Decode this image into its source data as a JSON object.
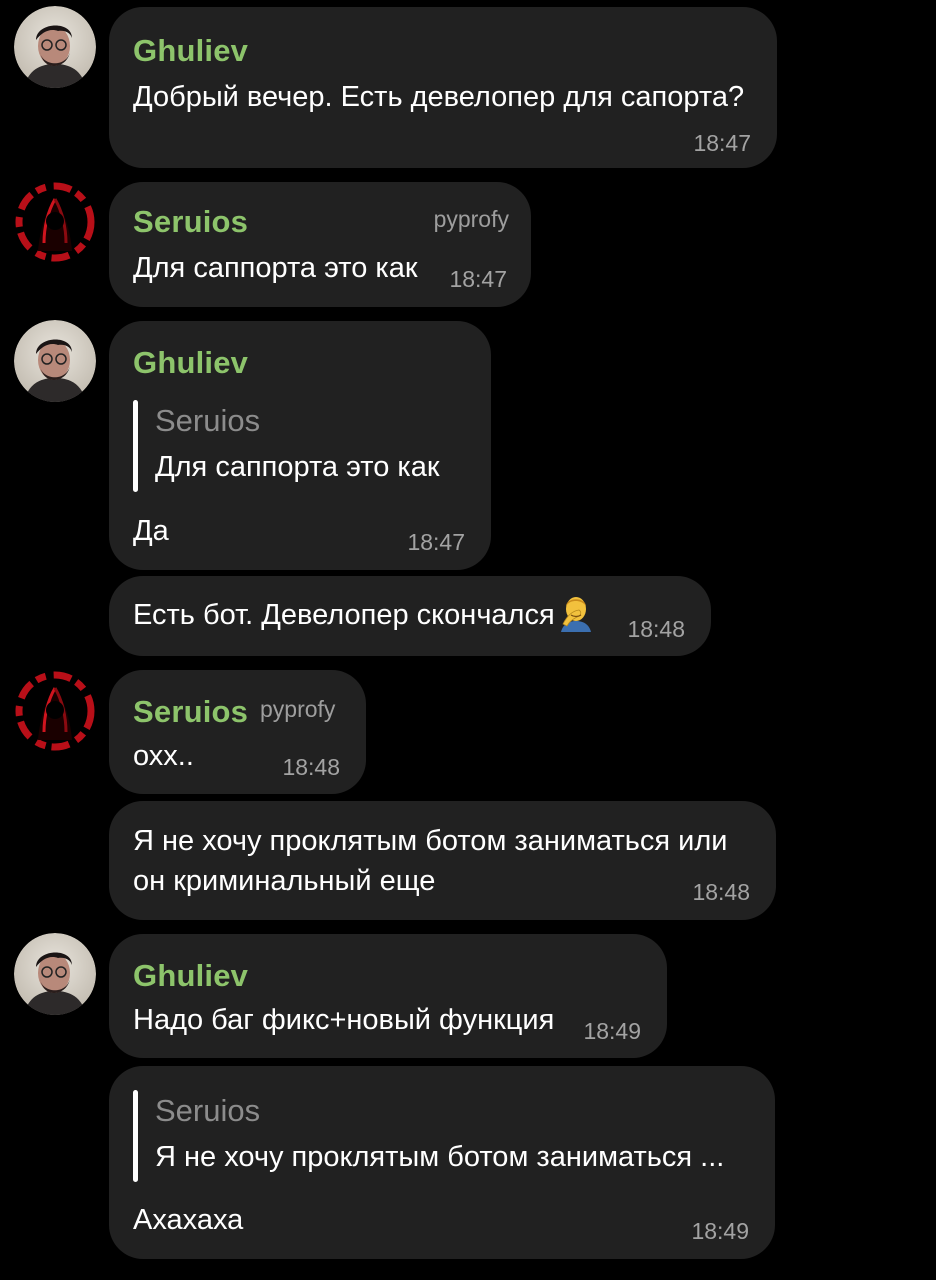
{
  "colors": {
    "background": "#000000",
    "bubble": "#212121",
    "sender_name": "#8dc46b",
    "timestamp": "#a3a3a3",
    "badge": "#9e9e9e",
    "quote_name": "#8c8c8c"
  },
  "messages": [
    {
      "sender": "Ghuliev",
      "text": "Добрый вечер. Есть девелопер для сапорта?",
      "time": "18:47",
      "avatar": "user-photo-avatar"
    },
    {
      "sender": "Seruios",
      "badge": "pyprofy",
      "text": "Для саппорта это как",
      "time": "18:47",
      "avatar": "red-dark-avatar"
    },
    {
      "sender": "Ghuliev",
      "reply_to": {
        "sender": "Seruios",
        "text": "Для саппорта это как"
      },
      "text": "Да",
      "time": "18:47",
      "avatar": "user-photo-avatar"
    },
    {
      "text": "Есть бот. Девелопер скончался",
      "emoji": "man-facepalming-emoji",
      "time": "18:48"
    },
    {
      "sender": "Seruios",
      "badge": "pyprofy",
      "text": "охх..",
      "time": "18:48",
      "avatar": "red-dark-avatar"
    },
    {
      "text_line1": "Я не хочу проклятым ботом заниматься или",
      "text_line2": "он криминальный еще",
      "time": "18:48"
    },
    {
      "sender": "Ghuliev",
      "text": "Надо баг фикс+новый функция",
      "time": "18:49",
      "avatar": "user-photo-avatar"
    },
    {
      "reply_to": {
        "sender": "Seruios",
        "text": "Я не хочу проклятым ботом заниматься ..."
      },
      "text": "Ахахаха",
      "time": "18:49"
    }
  ]
}
